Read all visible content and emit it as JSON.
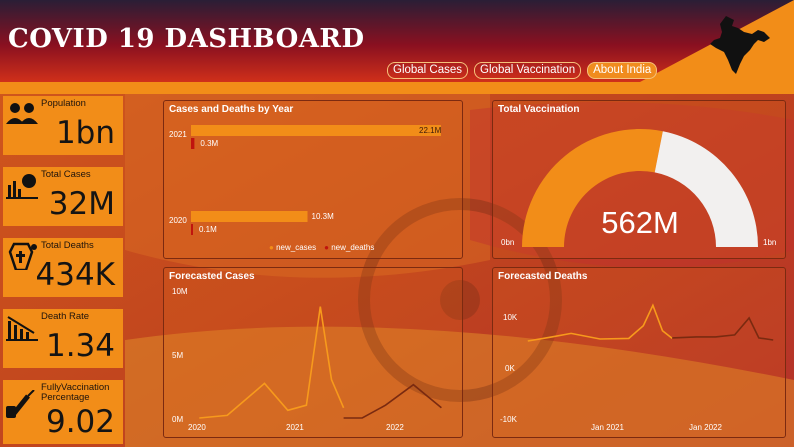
{
  "header": {
    "title": "COVID 19 DASHBOARD",
    "nav": [
      "Global Cases",
      "Global Vaccination",
      "About India"
    ],
    "active_nav": "About India"
  },
  "kpis": [
    {
      "label": "Population",
      "value": "1bn",
      "icon": "people-icon"
    },
    {
      "label": "Total Cases",
      "value": "32M",
      "icon": "virus-chart-icon"
    },
    {
      "label": "Total Deaths",
      "value": "434K",
      "icon": "coffin-icon"
    },
    {
      "label": "Death Rate",
      "value": "1.34",
      "icon": "declining-bars-icon"
    },
    {
      "label": "FullyVaccination Percentage",
      "value": "9.02",
      "icon": "vaccine-icon"
    }
  ],
  "cases_deaths": {
    "title": "Cases and Deaths by Year",
    "legend": [
      "new_cases",
      "new_deaths"
    ]
  },
  "vaccination": {
    "title": "Total Vaccination",
    "value": "562M",
    "min_label": "0bn",
    "max_label": "1bn"
  },
  "forecast_cases": {
    "title": "Forecasted Cases",
    "y_ticks": [
      "10M",
      "5M",
      "0M"
    ],
    "x_ticks": [
      "2020",
      "2021",
      "2022"
    ]
  },
  "forecast_deaths": {
    "title": "Forecasted Deaths",
    "y_ticks": [
      "10K",
      "0K",
      "-10K"
    ],
    "x_ticks": [
      "Jan 2021",
      "Jan 2022"
    ]
  },
  "colors": {
    "accent": "#f28d18",
    "deaths": "#c0140e",
    "forecast": "#7a2a10"
  },
  "chart_data": [
    {
      "type": "bar",
      "title": "Cases and Deaths by Year",
      "categories": [
        "2021",
        "2020"
      ],
      "series": [
        {
          "name": "new_cases",
          "values": [
            22100000,
            10300000
          ],
          "labels": [
            "22.1M",
            "10.3M"
          ]
        },
        {
          "name": "new_deaths",
          "values": [
            300000,
            100000
          ],
          "labels": [
            "0.3M",
            "0.1M"
          ]
        }
      ]
    },
    {
      "type": "gauge",
      "title": "Total Vaccination",
      "value": 0.562,
      "min": 0,
      "max": 1
    },
    {
      "type": "line",
      "title": "Forecasted Cases",
      "ylim": [
        0,
        10000000
      ],
      "series": [
        {
          "name": "actual",
          "points": [
            [
              2020.0,
              0
            ],
            [
              2020.3,
              200000
            ],
            [
              2020.7,
              2700000
            ],
            [
              2020.95,
              600000
            ],
            [
              2021.15,
              1000000
            ],
            [
              2021.3,
              8700000
            ],
            [
              2021.42,
              3000000
            ],
            [
              2021.55,
              800000
            ]
          ]
        },
        {
          "name": "forecast",
          "points": [
            [
              2021.55,
              0
            ],
            [
              2021.75,
              0
            ],
            [
              2022.0,
              1000000
            ],
            [
              2022.3,
              2600000
            ],
            [
              2022.6,
              800000
            ]
          ]
        }
      ]
    },
    {
      "type": "line",
      "title": "Forecasted Deaths",
      "ylim": [
        -10000,
        10000
      ],
      "series": [
        {
          "name": "actual",
          "points": [
            [
              2020.15,
              0
            ],
            [
              2020.4,
              800
            ],
            [
              2020.6,
              1500
            ],
            [
              2020.9,
              400
            ],
            [
              2021.2,
              500
            ],
            [
              2021.35,
              3000
            ],
            [
              2021.45,
              7000
            ],
            [
              2021.55,
              2000
            ],
            [
              2021.65,
              500
            ]
          ]
        },
        {
          "name": "forecast",
          "points": [
            [
              2021.65,
              600
            ],
            [
              2021.9,
              800
            ],
            [
              2022.1,
              800
            ],
            [
              2022.3,
              1200
            ],
            [
              2022.45,
              4500
            ],
            [
              2022.55,
              600
            ],
            [
              2022.7,
              200
            ]
          ]
        }
      ]
    }
  ]
}
